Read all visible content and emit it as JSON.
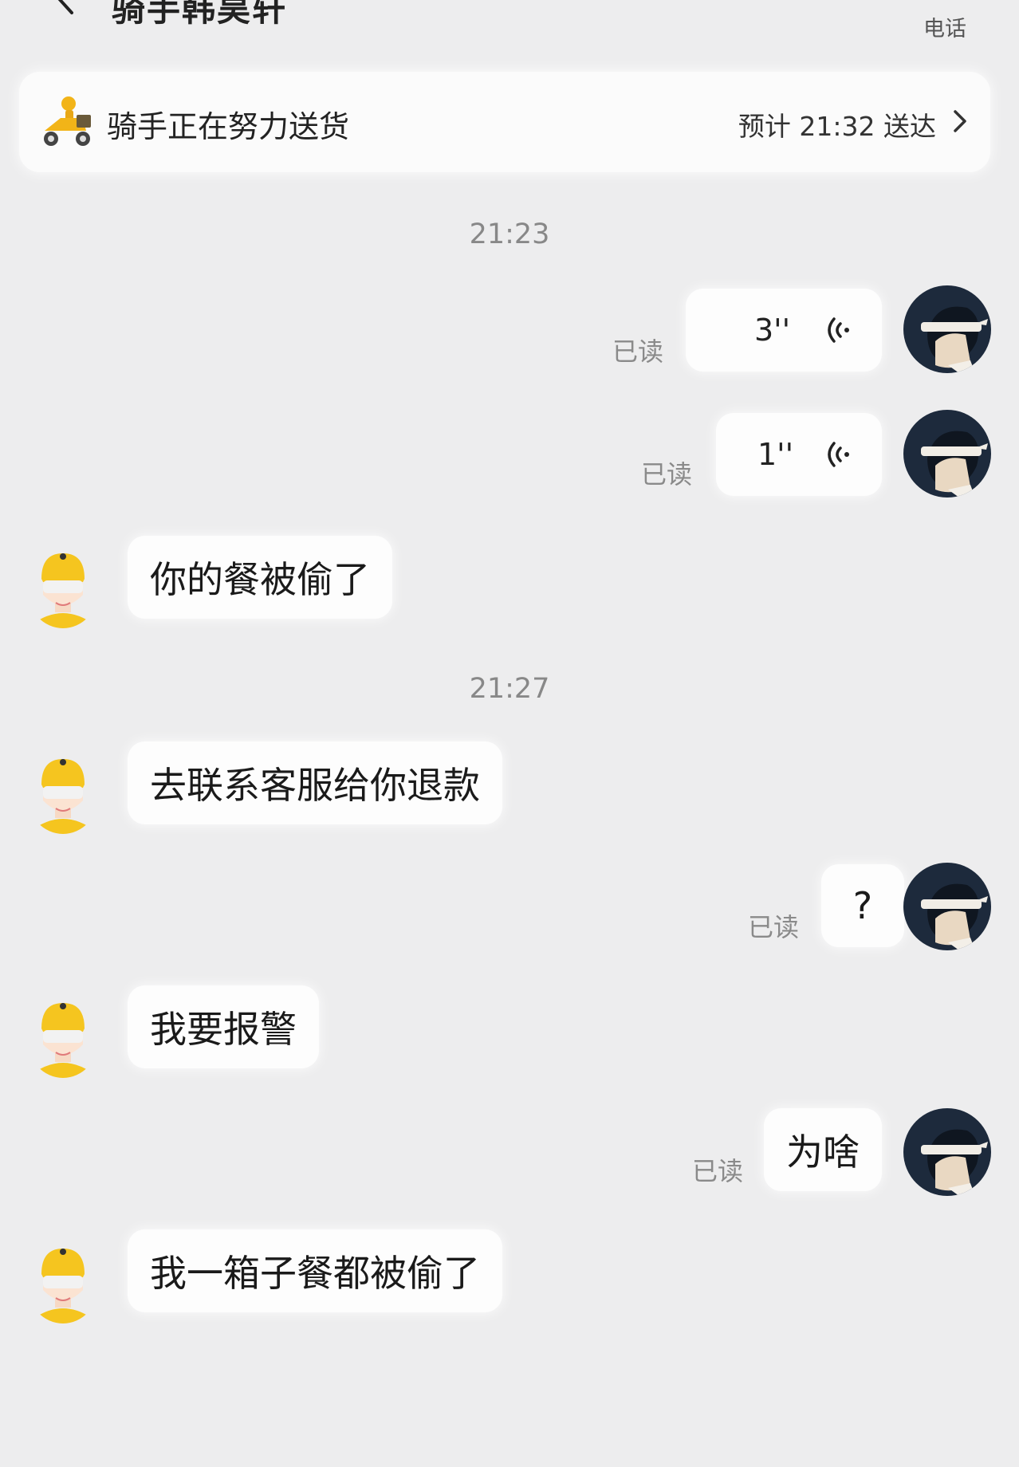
{
  "header": {
    "title": "骑手韩昊轩",
    "phone_label": "电话",
    "back_icon": "chevron-left-icon"
  },
  "delivery": {
    "status": "骑手正在努力送货",
    "eta": "预计 21:32 送达",
    "icon": "rider-scooter-icon"
  },
  "messages": {
    "time1": "21:23",
    "voice1_duration": "3''",
    "voice1_read": "已读",
    "voice2_duration": "1''",
    "voice2_read": "已读",
    "rider1": "你的餐被偷了",
    "time2": "21:27",
    "rider2": "去联系客服给你退款",
    "me1": "?",
    "me1_read": "已读",
    "rider3": "我要报警",
    "me2": "为啥",
    "me2_read": "已读",
    "rider4": "我一箱子餐都被偷了"
  },
  "colors": {
    "background": "#ededee",
    "bubble": "#fdfdfd",
    "rider_yellow": "#f5c51f",
    "avatar_dark": "#1d2a3c"
  }
}
